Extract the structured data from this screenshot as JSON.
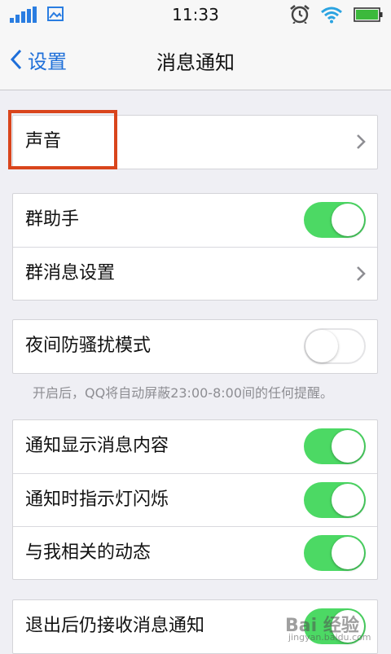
{
  "status_bar": {
    "time": "11:33",
    "icons": [
      "signal-icon",
      "image-icon",
      "alarm-icon",
      "wifi-icon",
      "battery-icon"
    ]
  },
  "nav": {
    "back_label": "设置",
    "title": "消息通知"
  },
  "groups": [
    {
      "rows": [
        {
          "label": "声音",
          "control": "chevron"
        }
      ]
    },
    {
      "rows": [
        {
          "label": "群助手",
          "control": "toggle",
          "on": true
        },
        {
          "label": "群消息设置",
          "control": "chevron"
        }
      ]
    },
    {
      "rows": [
        {
          "label": "夜间防骚扰模式",
          "control": "toggle",
          "on": false
        }
      ]
    },
    {
      "rows": [
        {
          "label": "通知显示消息内容",
          "control": "toggle",
          "on": true
        },
        {
          "label": "通知时指示灯闪烁",
          "control": "toggle",
          "on": true
        },
        {
          "label": "与我相关的动态",
          "control": "toggle",
          "on": true
        }
      ]
    },
    {
      "rows": [
        {
          "label": "退出后仍接收消息通知",
          "control": "toggle",
          "on": true
        }
      ]
    }
  ],
  "night_mode_hint": "开启后，QQ将自动屏蔽23:00-8:00间的任何提醒。",
  "colors": {
    "accent": "#1e6fd9",
    "toggle_on": "#4cd964",
    "highlight": "#d9451c",
    "background": "#efeff4"
  },
  "watermark": {
    "text": "Bai 经验",
    "sub": "jingyan.baidu.com"
  }
}
